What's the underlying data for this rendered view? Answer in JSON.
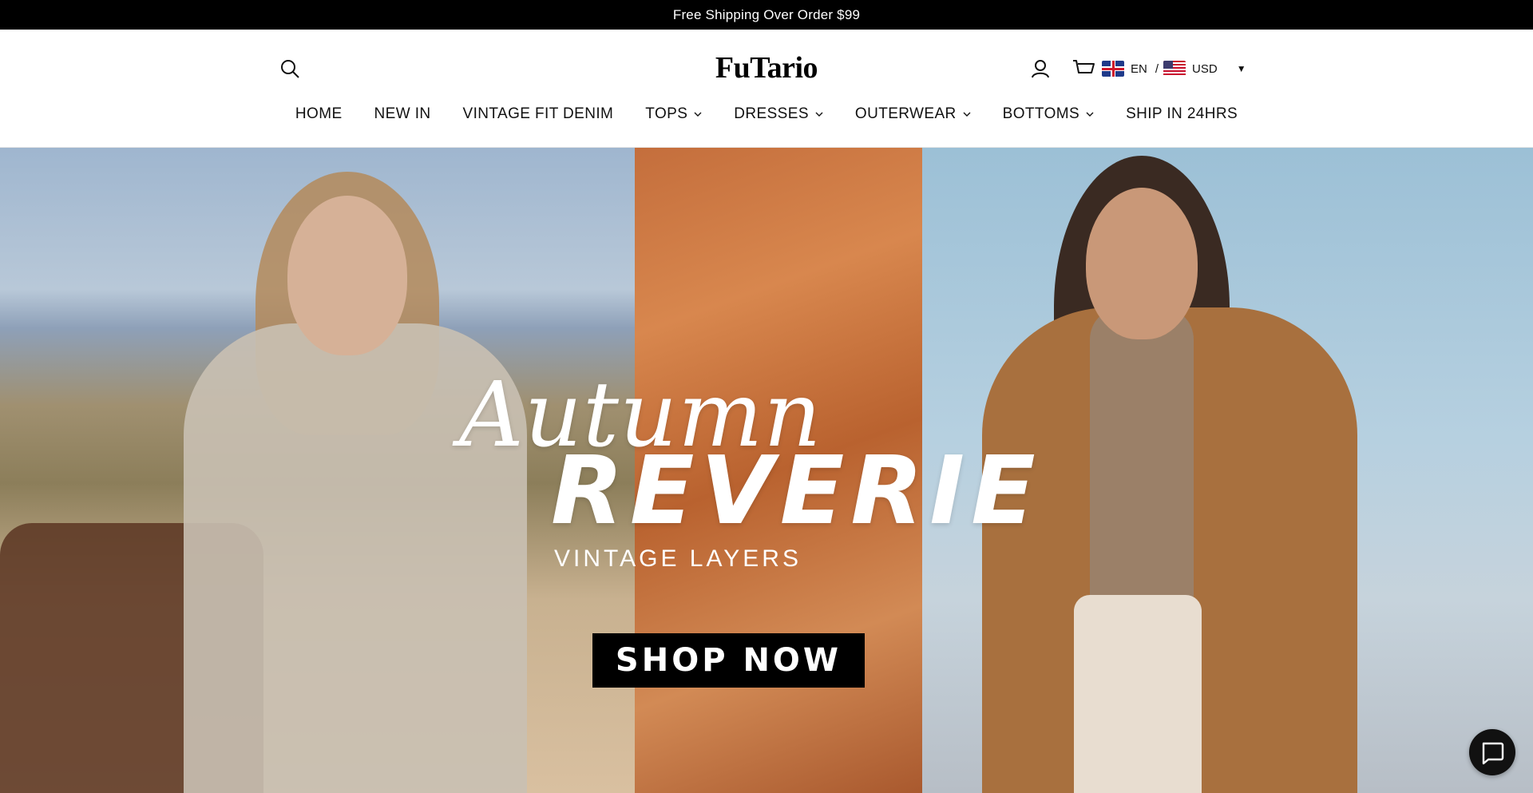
{
  "announcement": {
    "text": "Free Shipping Over Order $99"
  },
  "header": {
    "logo": "FuTario",
    "locale": {
      "language": "EN",
      "separator": "/",
      "currency": "USD"
    }
  },
  "nav": {
    "items": [
      {
        "label": "HOME",
        "has_dropdown": false
      },
      {
        "label": "NEW IN",
        "has_dropdown": false
      },
      {
        "label": "VINTAGE FIT DENIM",
        "has_dropdown": false
      },
      {
        "label": "TOPS",
        "has_dropdown": true
      },
      {
        "label": "DRESSES",
        "has_dropdown": true
      },
      {
        "label": "OUTERWEAR",
        "has_dropdown": true
      },
      {
        "label": "BOTTOMS",
        "has_dropdown": true
      },
      {
        "label": "SHIP IN 24HRS",
        "has_dropdown": false
      }
    ]
  },
  "hero": {
    "title_script": "Autumn",
    "title_bold": "REVERIE",
    "subtitle": "VINTAGE LAYERS",
    "cta": "SHOP NOW"
  },
  "icons": [
    "search-icon",
    "account-icon",
    "cart-icon",
    "uk-flag-icon",
    "us-flag-icon",
    "chevron-down-icon",
    "chat-icon"
  ],
  "colors": {
    "announcement_bg": "#000000",
    "cta_bg": "#000000",
    "text": "#111111"
  }
}
